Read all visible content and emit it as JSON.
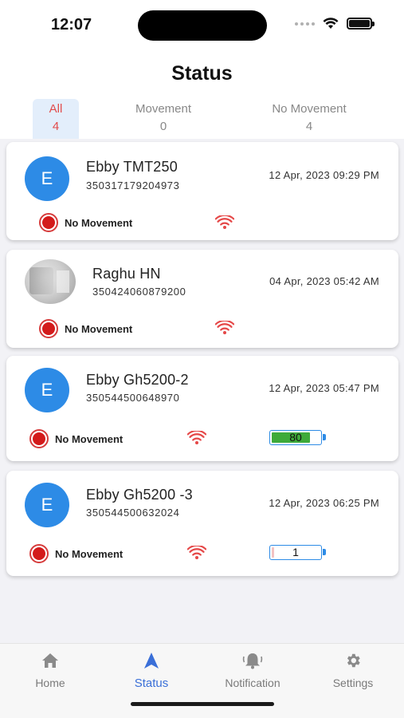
{
  "status_bar": {
    "time": "12:07"
  },
  "header": {
    "title": "Status"
  },
  "tabs": [
    {
      "label": "All",
      "count": "4"
    },
    {
      "label": "Movement",
      "count": "0"
    },
    {
      "label": "No Movement",
      "count": "4"
    }
  ],
  "devices": [
    {
      "avatar": "E",
      "name": "Ebby TMT250",
      "imei": "350317179204973",
      "date": "12 Apr, 2023 09:29 PM",
      "status": "No Movement"
    },
    {
      "avatar": "",
      "name": "Raghu HN",
      "imei": "350424060879200",
      "date": "04 Apr, 2023 05:42 AM",
      "status": "No Movement"
    },
    {
      "avatar": "E",
      "name": "Ebby Gh5200-2",
      "imei": "350544500648970",
      "date": "12 Apr, 2023 05:47 PM",
      "status": "No Movement",
      "battery": "80"
    },
    {
      "avatar": "E",
      "name": "Ebby Gh5200 -3",
      "imei": "350544500632024",
      "date": "12 Apr, 2023 06:25 PM",
      "status": "No Movement",
      "battery": "1"
    }
  ],
  "colors": {
    "accent": "#2d8be6",
    "alert": "#d31b1b",
    "wifi": "#e54848",
    "battery_ok": "#3eaa3a",
    "nav_active": "#3a6fd8"
  },
  "nav": [
    {
      "label": "Home",
      "icon": "home-icon"
    },
    {
      "label": "Status",
      "icon": "navigation-arrow-icon"
    },
    {
      "label": "Notification",
      "icon": "bell-icon"
    },
    {
      "label": "Settings",
      "icon": "gear-icon"
    }
  ]
}
